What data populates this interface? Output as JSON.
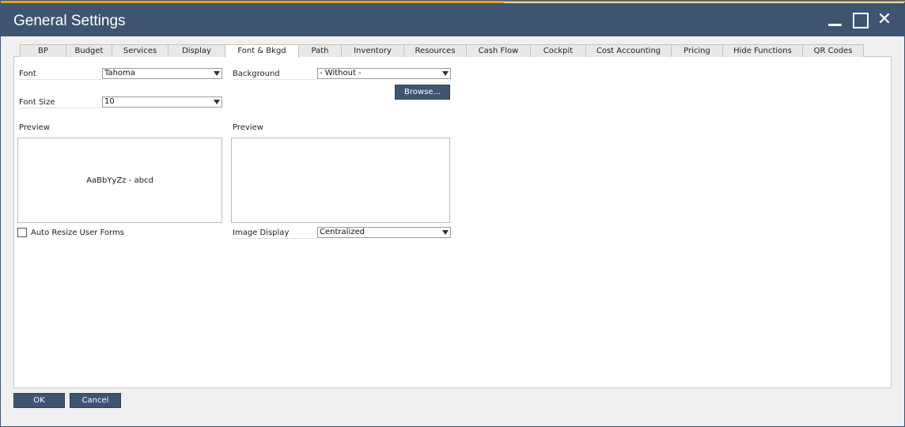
{
  "window": {
    "title": "General Settings"
  },
  "tabs": [
    {
      "label": "BP",
      "w": 0
    },
    {
      "label": "Budget"
    },
    {
      "label": "Services"
    },
    {
      "label": "Display"
    },
    {
      "label": "Font & Bkgd"
    },
    {
      "label": "Path"
    },
    {
      "label": "Inventory"
    },
    {
      "label": "Resources"
    },
    {
      "label": "Cash Flow"
    },
    {
      "label": "Cockpit"
    },
    {
      "label": "Cost Accounting"
    },
    {
      "label": "Pricing"
    },
    {
      "label": "Hide Functions"
    },
    {
      "label": "QR Codes"
    }
  ],
  "active_tab": "Font & Bkgd",
  "font": {
    "label": "Font",
    "value": "Tahoma"
  },
  "font_size": {
    "label": "Font Size",
    "value": "10"
  },
  "background": {
    "label": "Background",
    "value": "- Without -"
  },
  "browse_label": "Browse...",
  "font_preview": {
    "label": "Preview",
    "sample": "AaBbYyZz - abcd"
  },
  "bg_preview": {
    "label": "Preview"
  },
  "auto_resize": {
    "label": "Auto Resize User Forms",
    "checked": false
  },
  "image_display": {
    "label": "Image Display",
    "value": "Centralized"
  },
  "footer": {
    "ok_label": "OK",
    "cancel_label": "Cancel"
  },
  "colors": {
    "titlebar": "#3d5570",
    "accent": "#e8a317"
  }
}
